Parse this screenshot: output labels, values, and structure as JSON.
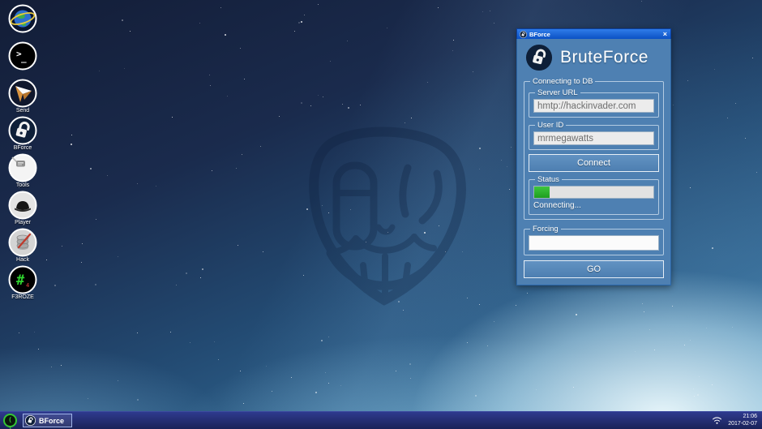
{
  "desktop": {
    "icons": [
      {
        "name": "browser",
        "label": ""
      },
      {
        "name": "console",
        "label": ""
      },
      {
        "name": "send",
        "label": "Send"
      },
      {
        "name": "bforce",
        "label": "BForce"
      },
      {
        "name": "tools",
        "label": "Tools"
      },
      {
        "name": "player",
        "label": "Player"
      },
      {
        "name": "hack",
        "label": "Hack"
      },
      {
        "name": "matrix",
        "label": "F3ROZE"
      }
    ]
  },
  "window": {
    "title": "BForce",
    "close_label": "×",
    "app_title": "BruteForce",
    "group_connecting_label": "Connecting to DB",
    "server_url_label": "Server URL",
    "server_url_value": "hmtp://hackinvader.com",
    "user_id_label": "User ID",
    "user_id_value": "mrmegawatts",
    "connect_label": "Connect",
    "status_label": "Status",
    "progress_percent": 13,
    "status_text": "Connecting...",
    "forcing_label": "Forcing",
    "forcing_value": "",
    "go_label": "GO"
  },
  "taskbar": {
    "task_item_label": "BForce",
    "clock_time": "21:06",
    "clock_date": "2017-02-07"
  },
  "colors": {
    "titlebar_blue": "#0b51c4",
    "window_body_blue": "#4e80b2",
    "progress_green": "#2db52d",
    "taskbar_navy": "#232d70",
    "start_green": "#35c435"
  }
}
